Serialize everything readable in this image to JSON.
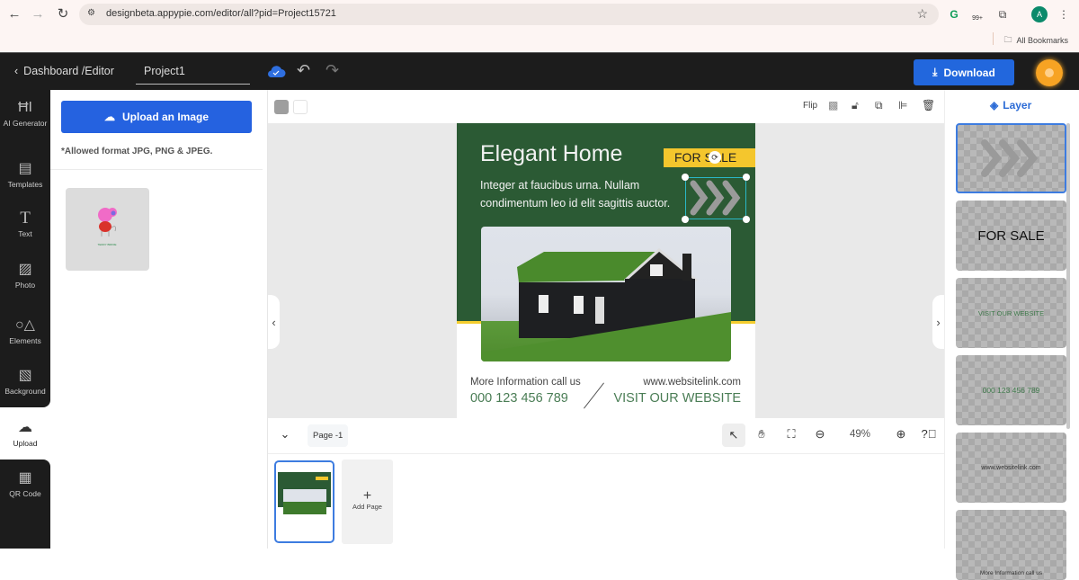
{
  "browser": {
    "url": "designbeta.appypie.com/editor/all?pid=Project15721",
    "badge_count": "99+",
    "profile_initial": "A",
    "bookmarks_label": "All Bookmarks"
  },
  "appbar": {
    "back_label": "Dashboard /Editor",
    "project_name": "Project1",
    "download_label": "Download",
    "accent": "#2267dd"
  },
  "leftnav": {
    "items": [
      {
        "label": "AI Generator",
        "icon": "ai-icon"
      },
      {
        "label": "Templates",
        "icon": "templates-icon"
      },
      {
        "label": "Text",
        "icon": "text-icon"
      },
      {
        "label": "Photo",
        "icon": "photo-icon"
      },
      {
        "label": "Elements",
        "icon": "elements-icon"
      },
      {
        "label": "Background",
        "icon": "background-icon"
      },
      {
        "label": "Upload",
        "icon": "upload-cloud-icon",
        "active": true
      },
      {
        "label": "QR Code",
        "icon": "qr-code-icon"
      }
    ]
  },
  "upload_panel": {
    "button_label": "Upload an Image",
    "allowed_formats": "*Allowed format JPG, PNG & JPEG.",
    "uploaded_caption": "TEDDY BIRDIE"
  },
  "toolbar": {
    "flip_label": "Flip"
  },
  "design": {
    "title": "Elegant Home",
    "for_sale": "FOR SALE",
    "subtitle": "Integer at faucibus urna. Nullam condimentum leo id elit sagittis auctor.",
    "info_label": "More Information call us",
    "phone": "000 123 456 789",
    "website": "www.websitelink.com",
    "visit": "VISIT OUR WEBSITE",
    "colors": {
      "green": "#2b5a34",
      "yellow": "#f4c62d",
      "text_green": "#4a7d55"
    }
  },
  "bottombar": {
    "page_label": "Page -1",
    "zoom": "49%"
  },
  "pages": {
    "add_page_label": "Add Page"
  },
  "layers": {
    "header": "Layer",
    "items": [
      {
        "label": "",
        "type": "chevrons"
      },
      {
        "label": "FOR SALE"
      },
      {
        "label": "VISIT OUR WEBSITE"
      },
      {
        "label": "000 123 456 789"
      },
      {
        "label": "www.websitelink.com"
      },
      {
        "label": "More Information call us"
      }
    ]
  }
}
